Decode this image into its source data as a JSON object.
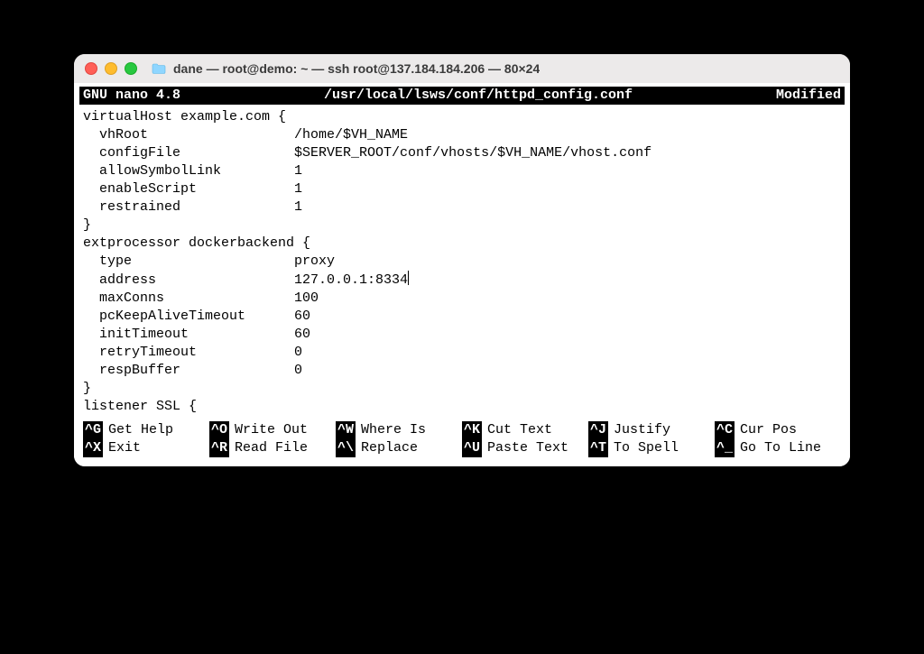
{
  "window": {
    "title": "dane — root@demo: ~ — ssh root@137.184.184.206 — 80×24"
  },
  "nano": {
    "app": "GNU nano 4.8",
    "file": "/usr/local/lsws/conf/httpd_config.conf",
    "state": "Modified"
  },
  "lines": [
    "",
    "virtualHost example.com {",
    "  vhRoot                  /home/$VH_NAME",
    "  configFile              $SERVER_ROOT/conf/vhosts/$VH_NAME/vhost.conf",
    "  allowSymbolLink         1",
    "  enableScript            1",
    "  restrained              1",
    "}",
    "",
    "extprocessor dockerbackend {",
    "  type                    proxy",
    "  address                 127.0.0.1:8334",
    "  maxConns                100",
    "  pcKeepAliveTimeout      60",
    "  initTimeout             60",
    "  retryTimeout            0",
    "  respBuffer              0",
    "}",
    "",
    "listener SSL {"
  ],
  "cursor_line_index": 11,
  "shortcuts": {
    "row1": [
      {
        "key": "^G",
        "label": "Get Help"
      },
      {
        "key": "^O",
        "label": "Write Out"
      },
      {
        "key": "^W",
        "label": "Where Is"
      },
      {
        "key": "^K",
        "label": "Cut Text"
      },
      {
        "key": "^J",
        "label": "Justify"
      },
      {
        "key": "^C",
        "label": "Cur Pos"
      }
    ],
    "row2": [
      {
        "key": "^X",
        "label": "Exit"
      },
      {
        "key": "^R",
        "label": "Read File"
      },
      {
        "key": "^\\",
        "label": "Replace"
      },
      {
        "key": "^U",
        "label": "Paste Text"
      },
      {
        "key": "^T",
        "label": "To Spell"
      },
      {
        "key": "^_",
        "label": "Go To Line"
      }
    ]
  }
}
